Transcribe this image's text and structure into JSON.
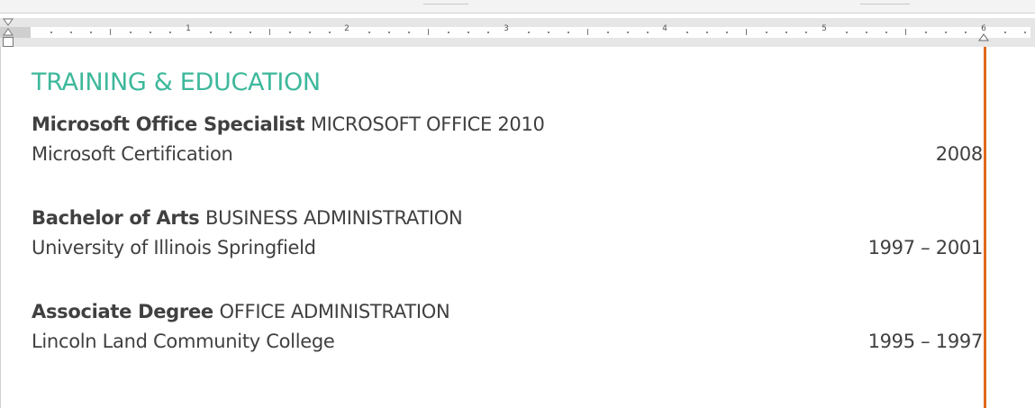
{
  "ruler": {
    "numbers": [
      "1",
      "2",
      "3",
      "4",
      "5",
      "6"
    ]
  },
  "document": {
    "section_title": "TRAINING & EDUCATION",
    "entries": [
      {
        "degree": "Microsoft Office Specialist",
        "field": "MICROSOFT OFFICE 2010",
        "school": "Microsoft Certification",
        "dates": "2008"
      },
      {
        "degree": "Bachelor of Arts",
        "field": "BUSINESS ADMINISTRATION",
        "school": "University of Illinois Springfield",
        "dates": "1997 – 2001"
      },
      {
        "degree": "Associate Degree",
        "field": "OFFICE ADMINISTRATION",
        "school": "Lincoln Land Community College",
        "dates": "1995 – 1997"
      }
    ]
  },
  "colors": {
    "heading": "#3db89b",
    "body_text": "#404040",
    "right_margin_indicator": "#e06a1a"
  }
}
